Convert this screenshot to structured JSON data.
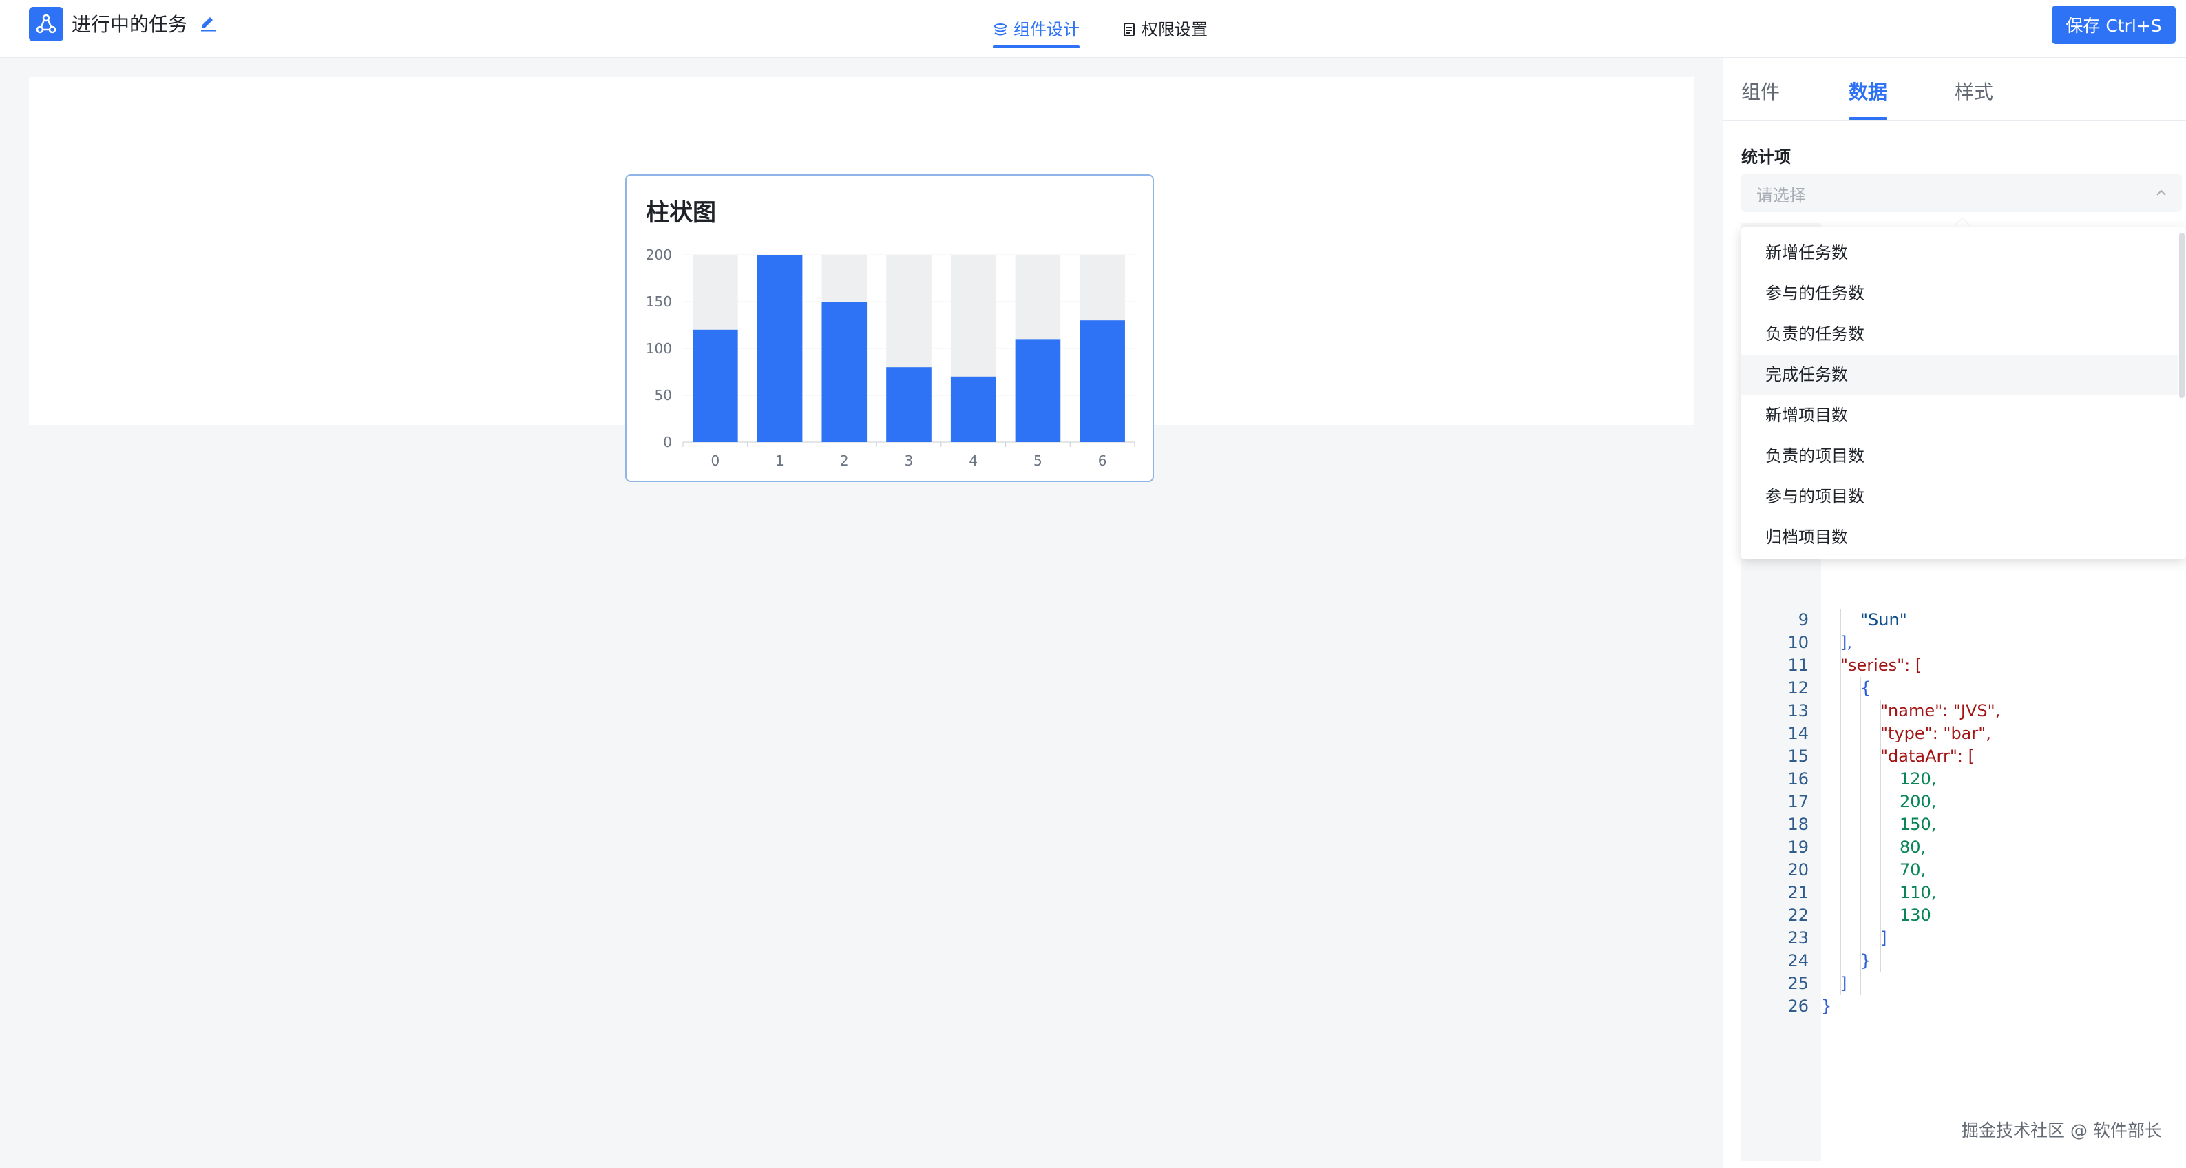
{
  "header": {
    "app_title": "进行中的任务",
    "tabs": [
      {
        "label": "组件设计",
        "active": true
      },
      {
        "label": "权限设置",
        "active": false
      }
    ],
    "save_label": "保存 Ctrl+S"
  },
  "colors": {
    "accent": "#2e72f6",
    "bar_fill": "#2e72f6",
    "bar_background": "#eeeff1"
  },
  "chart": {
    "title": "柱状图"
  },
  "chart_data": {
    "type": "bar",
    "title": "柱状图",
    "categories": [
      "0",
      "1",
      "2",
      "3",
      "4",
      "5",
      "6"
    ],
    "series": [
      {
        "values": [
          120,
          200,
          150,
          80,
          70,
          110,
          130
        ]
      }
    ],
    "background_values": [
      200,
      200,
      200,
      200,
      200,
      200,
      200
    ],
    "ylim": [
      0,
      200
    ],
    "yticks": [
      0,
      50,
      100,
      150,
      200
    ],
    "xlabel": "",
    "ylabel": "",
    "grid": true,
    "legend": "none"
  },
  "panel": {
    "tabs": [
      {
        "label": "组件",
        "active": false
      },
      {
        "label": "数据",
        "active": true
      },
      {
        "label": "样式",
        "active": false
      }
    ],
    "field_label": "统计项",
    "select_placeholder": "请选择",
    "dropdown_items": [
      "新增任务数",
      "参与的任务数",
      "负责的任务数",
      "完成任务数",
      "新增项目数",
      "负责的项目数",
      "参与的项目数",
      "归档项目数"
    ],
    "hover_index": 3
  },
  "code": {
    "lines": [
      {
        "n": "9",
        "text": "\"Sun\""
      },
      {
        "n": "10",
        "text": "],"
      },
      {
        "n": "11",
        "text": "\"series\": ["
      },
      {
        "n": "12",
        "text": "{"
      },
      {
        "n": "13",
        "text": "\"name\": \"JVS\","
      },
      {
        "n": "14",
        "text": "\"type\": \"bar\","
      },
      {
        "n": "15",
        "text": "\"dataArr\": ["
      },
      {
        "n": "16",
        "text": "120,"
      },
      {
        "n": "17",
        "text": "200,"
      },
      {
        "n": "18",
        "text": "150,"
      },
      {
        "n": "19",
        "text": "80,"
      },
      {
        "n": "20",
        "text": "70,"
      },
      {
        "n": "21",
        "text": "110,"
      },
      {
        "n": "22",
        "text": "130"
      },
      {
        "n": "23",
        "text": "]"
      },
      {
        "n": "24",
        "text": "}"
      },
      {
        "n": "25",
        "text": "]"
      },
      {
        "n": "26",
        "text": "}"
      }
    ]
  },
  "watermark": "掘金技术社区 @ 软件部长"
}
